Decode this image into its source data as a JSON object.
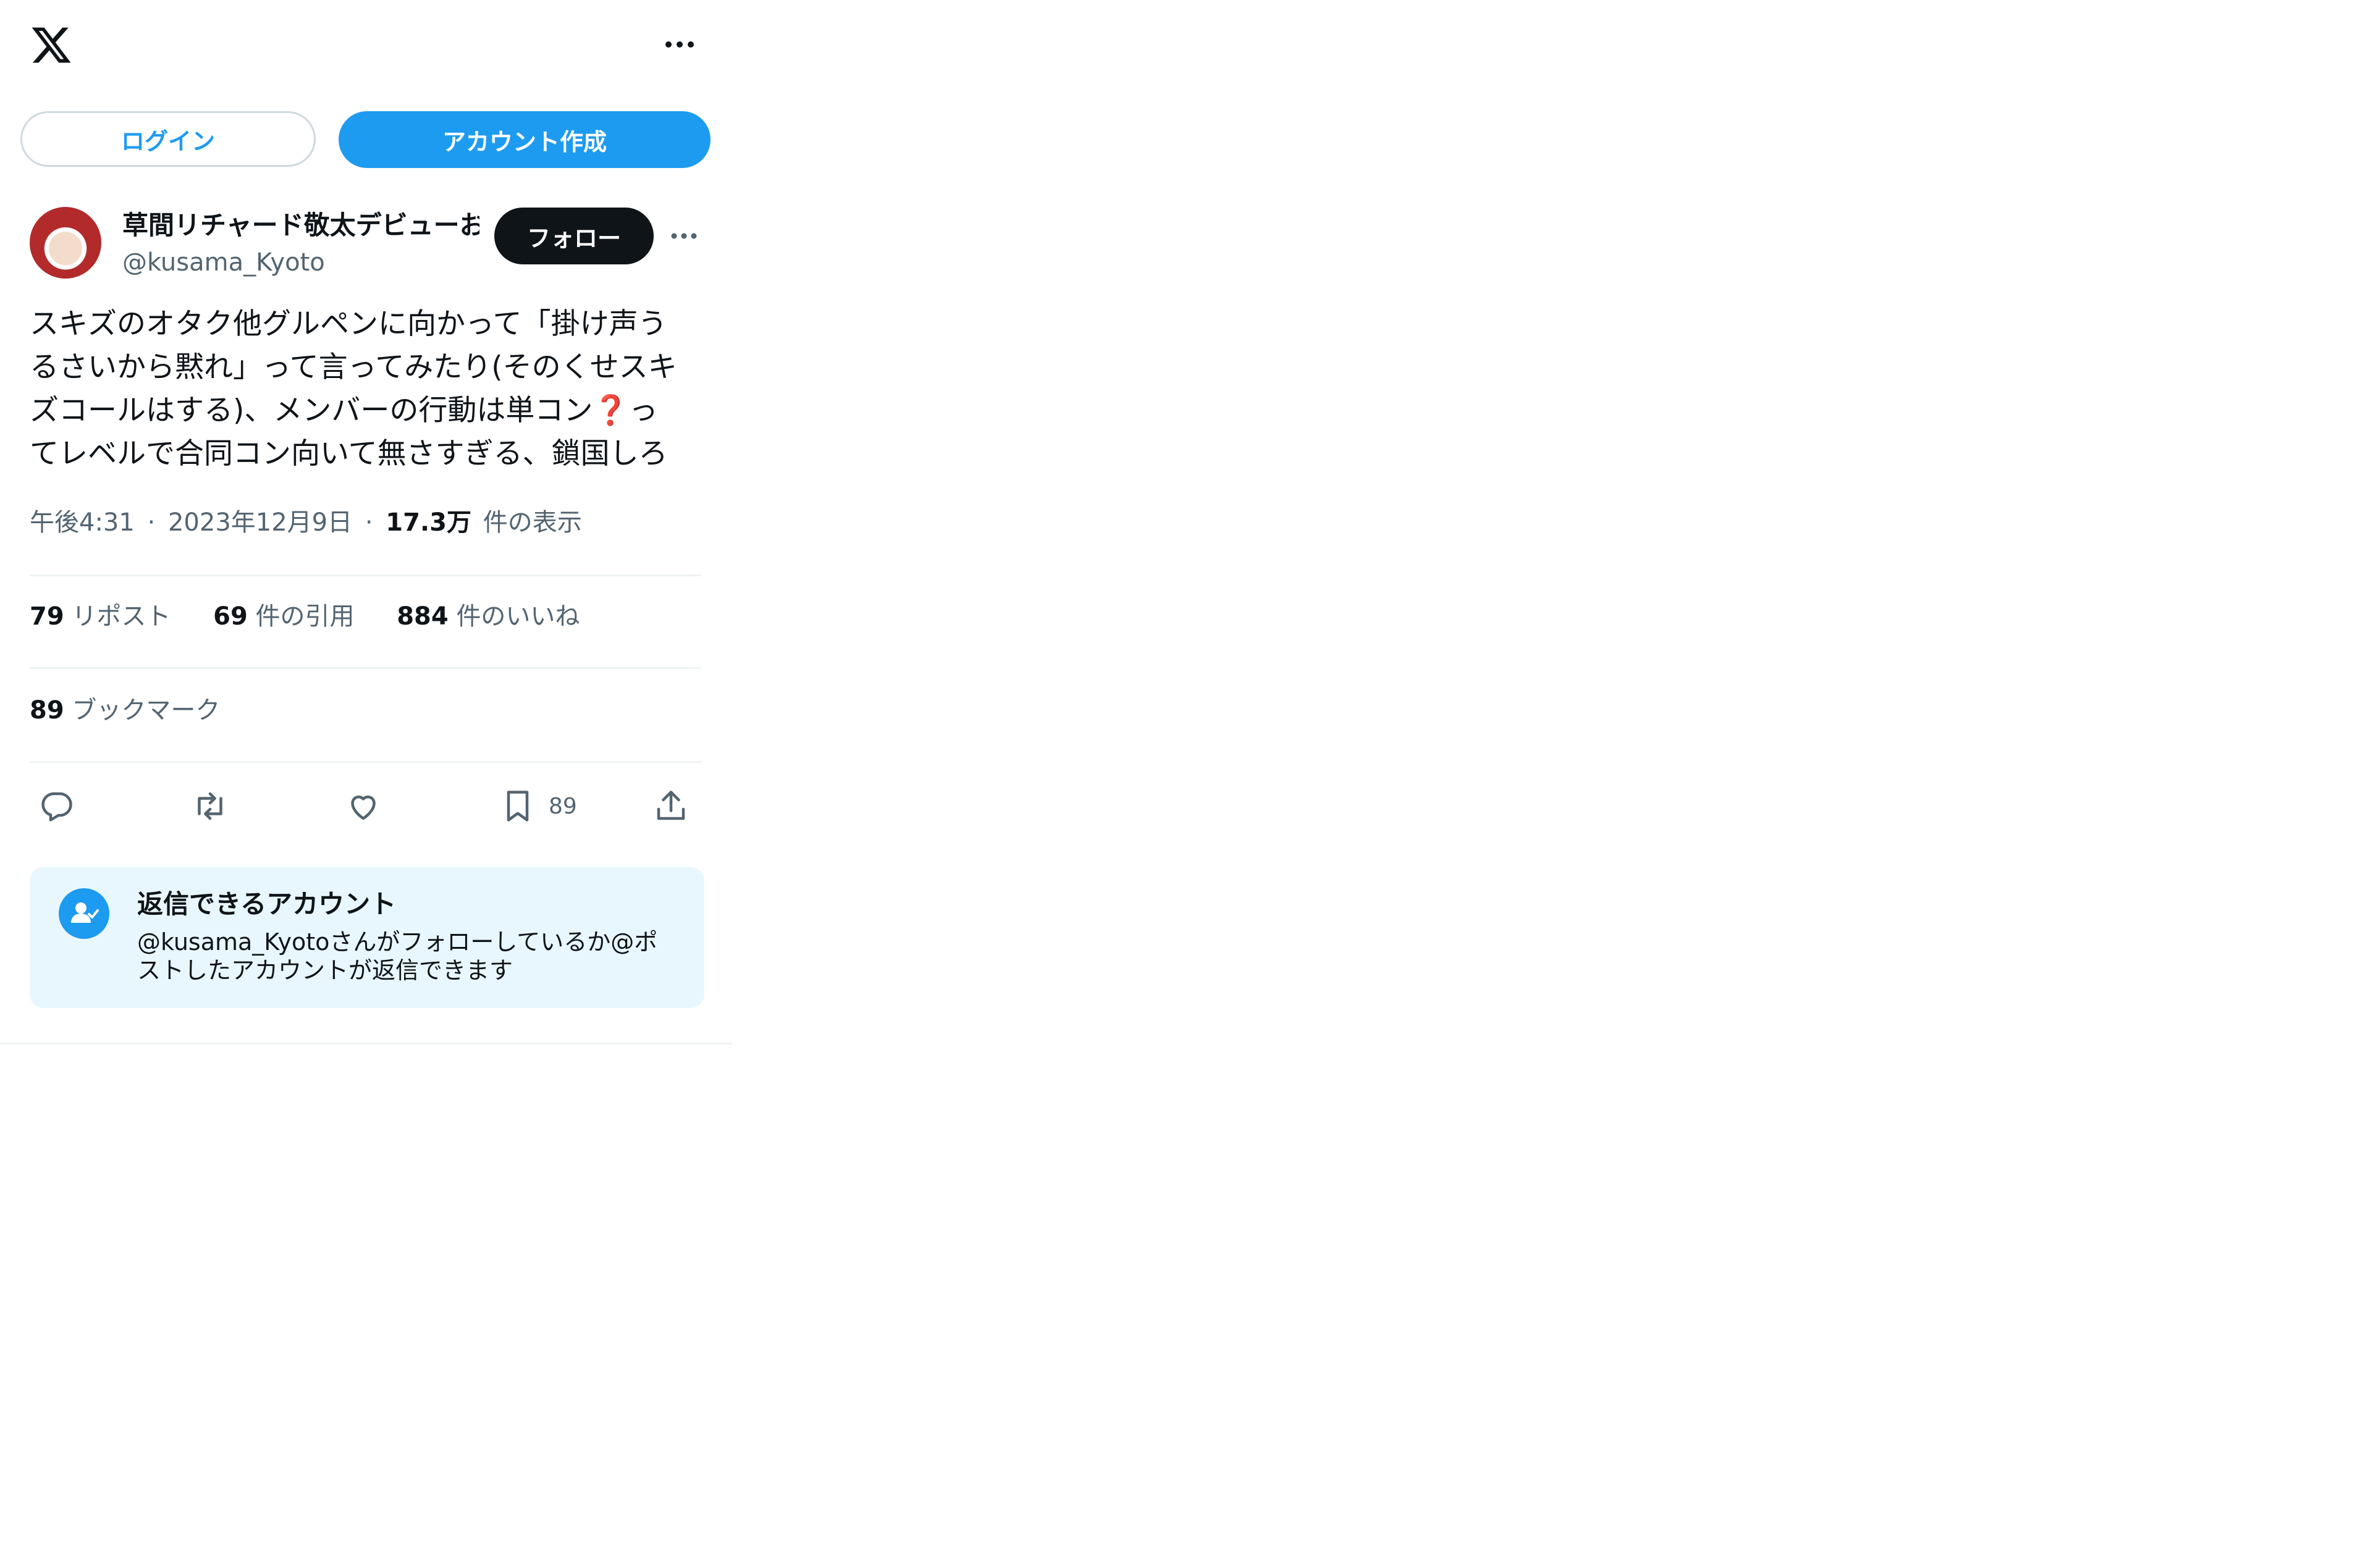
{
  "header": {
    "logo": "x-logo-icon",
    "more_icon": "more-horizontal-icon"
  },
  "auth": {
    "login_label": "ログイン",
    "signup_label": "アカウント作成"
  },
  "author": {
    "display_name": "草間リチャード敬太デビューおめでとう",
    "handle": "@kusama_Kyoto",
    "follow_label": "フォロー"
  },
  "tweet": {
    "lines": [
      "スキズのオタク他グルペンに向かって「掛け声う",
      "るさいから黙れ」って言ってみたり(そのくせスキ",
      "ズコールはする)、メンバーの行動は単コン",
      "てレベルで合同コン向いて無さすぎる、鎖国しろ"
    ],
    "emoji": "❓",
    "line3_tail": "っ"
  },
  "meta": {
    "time": "午後4:31",
    "date": "2023年12月9日",
    "separator": "·",
    "views_count": "17.3万",
    "views_label": "件の表示"
  },
  "stats": {
    "reposts_count": "79",
    "reposts_label": "リポスト",
    "quotes_count": "69",
    "quotes_label": "件の引用",
    "likes_count": "884",
    "likes_label": "件のいいね",
    "bookmarks_count": "89",
    "bookmarks_label": "ブックマーク"
  },
  "actions": {
    "reply_icon": "reply-icon",
    "repost_icon": "repost-icon",
    "like_icon": "heart-icon",
    "bookmark_icon": "bookmark-icon",
    "bookmark_count": "89",
    "share_icon": "share-icon"
  },
  "reply_notice": {
    "title": "返信できるアカウント",
    "body_line1": "@kusama_Kyotoさんがフォローしているか@ポ",
    "body_line2": "ストしたアカウントが返信できます"
  },
  "colors": {
    "accent": "#1d9bf0",
    "text_primary": "#0f1419",
    "text_secondary": "#536471",
    "notice_bg": "#e8f7fd",
    "divider": "#eff3f4"
  }
}
